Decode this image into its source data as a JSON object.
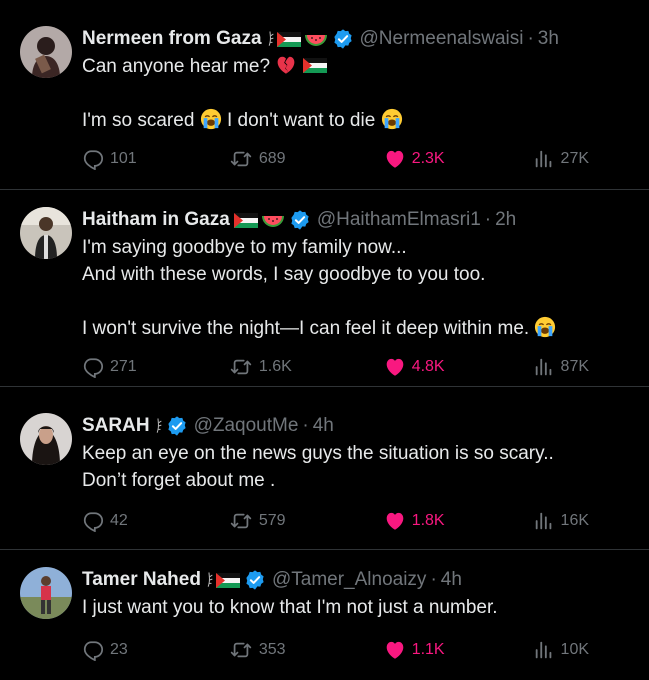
{
  "tweets": [
    {
      "name": "Nermeen from Gaza",
      "handle": "@Nermeenalswaisi",
      "time": "3h",
      "lines": [
        "Can anyone hear me?",
        "",
        "I'm so scared",
        "I don't want to die"
      ],
      "replies": "101",
      "retweets": "689",
      "likes": "2.3K",
      "views": "27K"
    },
    {
      "name": "Haitham in Gaza",
      "handle": "@HaithamElmasri1",
      "time": "2h",
      "lines": [
        "I'm saying goodbye to my family now...",
        "And with these words, I say goodbye to you too.",
        "",
        "I won't survive the night—I can feel it deep within me."
      ],
      "replies": "271",
      "retweets": "1.6K",
      "likes": "4.8K",
      "views": "87K"
    },
    {
      "name": "SARAH",
      "handle": "@ZaqoutMe",
      "time": "4h",
      "lines": [
        "Keep an eye on the news guys the situation is so scary..",
        "Don’t forget about me ."
      ],
      "replies": "42",
      "retweets": "579",
      "likes": "1.8K",
      "views": "16K"
    },
    {
      "name": "Tamer Nahed",
      "handle": "@Tamer_Alnoaizy",
      "time": "4h",
      "lines": [
        "I just want you to know that I'm not just a number."
      ],
      "replies": "23",
      "retweets": "353",
      "likes": "1.1K",
      "views": "10K"
    }
  ],
  "separator": "·",
  "colors": {
    "background": "#000000",
    "text": "#e7e9ea",
    "muted": "#71767b",
    "like": "#f91880",
    "verified": "#1d9bf0",
    "divider": "#2f3336"
  },
  "icons": [
    "reply-icon",
    "retweet-icon",
    "heart-icon",
    "views-icon",
    "verified-badge-icon",
    "palestine-flag-icon",
    "watermelon-icon",
    "crying-face-icon",
    "broken-heart-icon",
    "olive-branch-icon"
  ]
}
